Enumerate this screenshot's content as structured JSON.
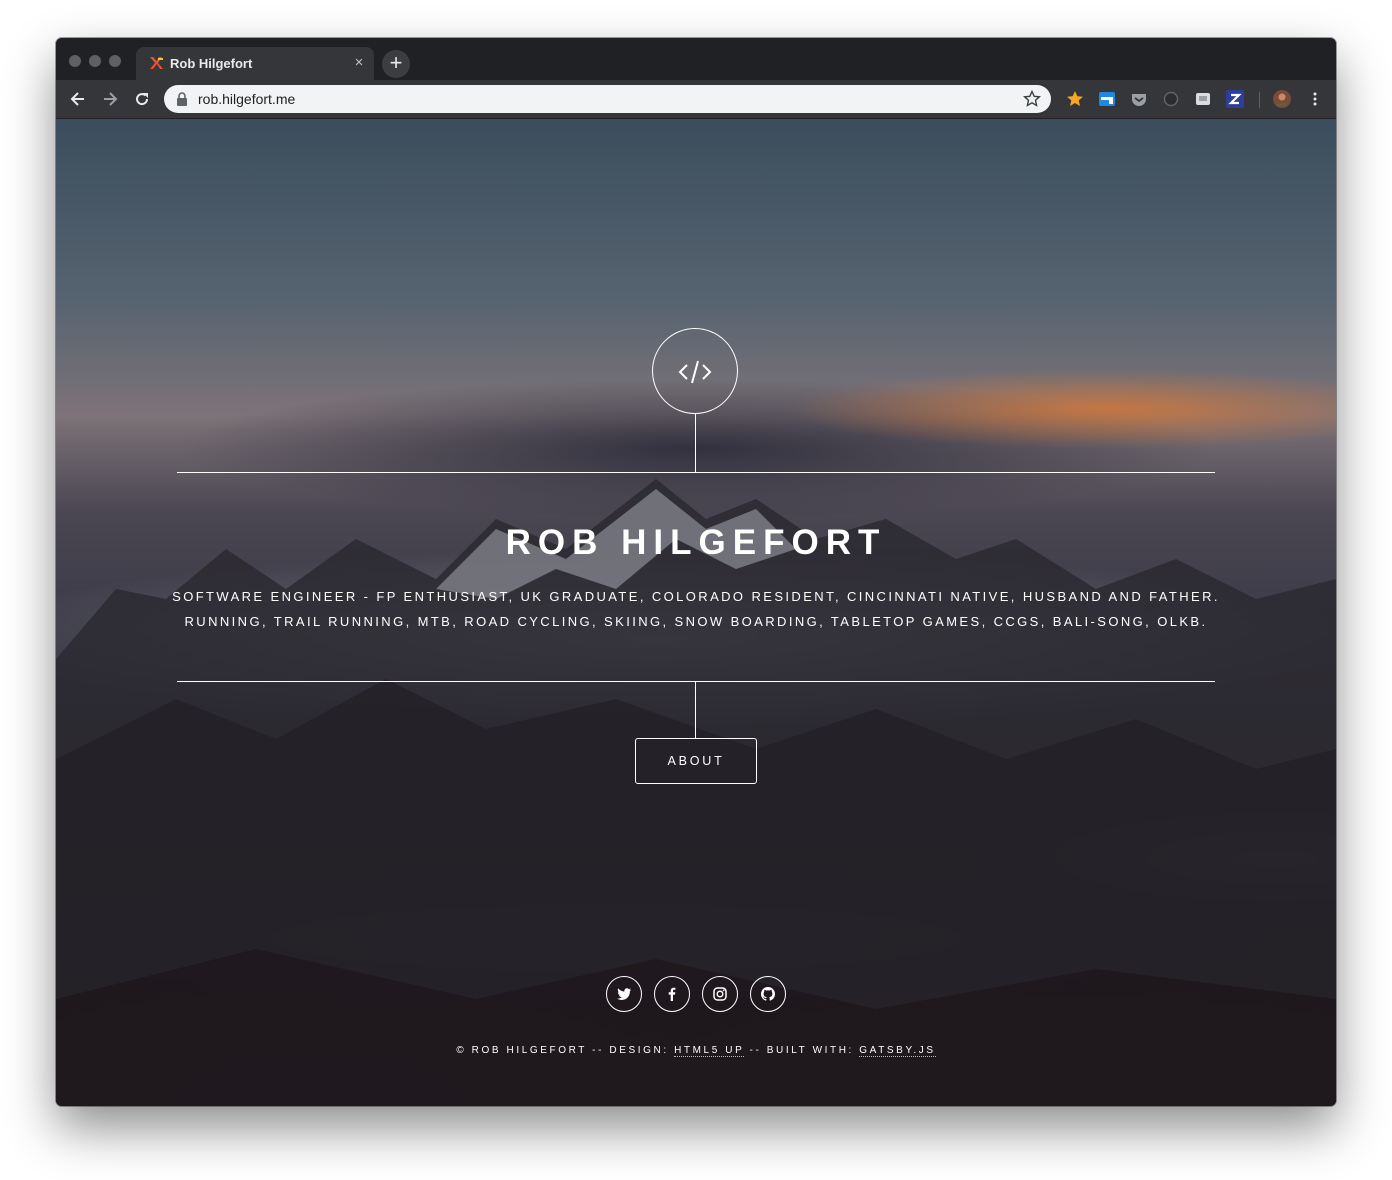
{
  "browser": {
    "tab_title": "Rob Hilgefort",
    "tab_close": "×",
    "new_tab": "+",
    "url": "rob.hilgefort.me",
    "extensions": [
      "bookmark-star-ext",
      "window-ext",
      "pocket-ext",
      "circle-ext",
      "printer-ext",
      "z-ext",
      "profile-avatar"
    ]
  },
  "hero": {
    "icon": "code-icon",
    "title": "ROB HILGEFORT",
    "description_line1": "SOFTWARE ENGINEER - FP ENTHUSIAST, UK GRADUATE, COLORADO RESIDENT, CINCINNATI NATIVE, HUSBAND AND FATHER.",
    "description_line2": "RUNNING, TRAIL RUNNING, MTB, ROAD CYCLING, SKIING, SNOW BOARDING, TABLETOP GAMES, CCGS, BALI-SONG, OLKB.",
    "about_label": "ABOUT"
  },
  "social": [
    "twitter-icon",
    "facebook-icon",
    "instagram-icon",
    "github-icon"
  ],
  "footer": {
    "prefix": "© ROB HILGEFORT -- DESIGN: ",
    "design_link": "HTML5 UP",
    "middle": " -- BUILT WITH: ",
    "built_link": "GATSBY.JS"
  },
  "colors": {
    "chrome_dark": "#202124",
    "chrome_toolbar": "#35363a",
    "omnibox": "#f1f3f4",
    "text_white": "#ffffff"
  }
}
